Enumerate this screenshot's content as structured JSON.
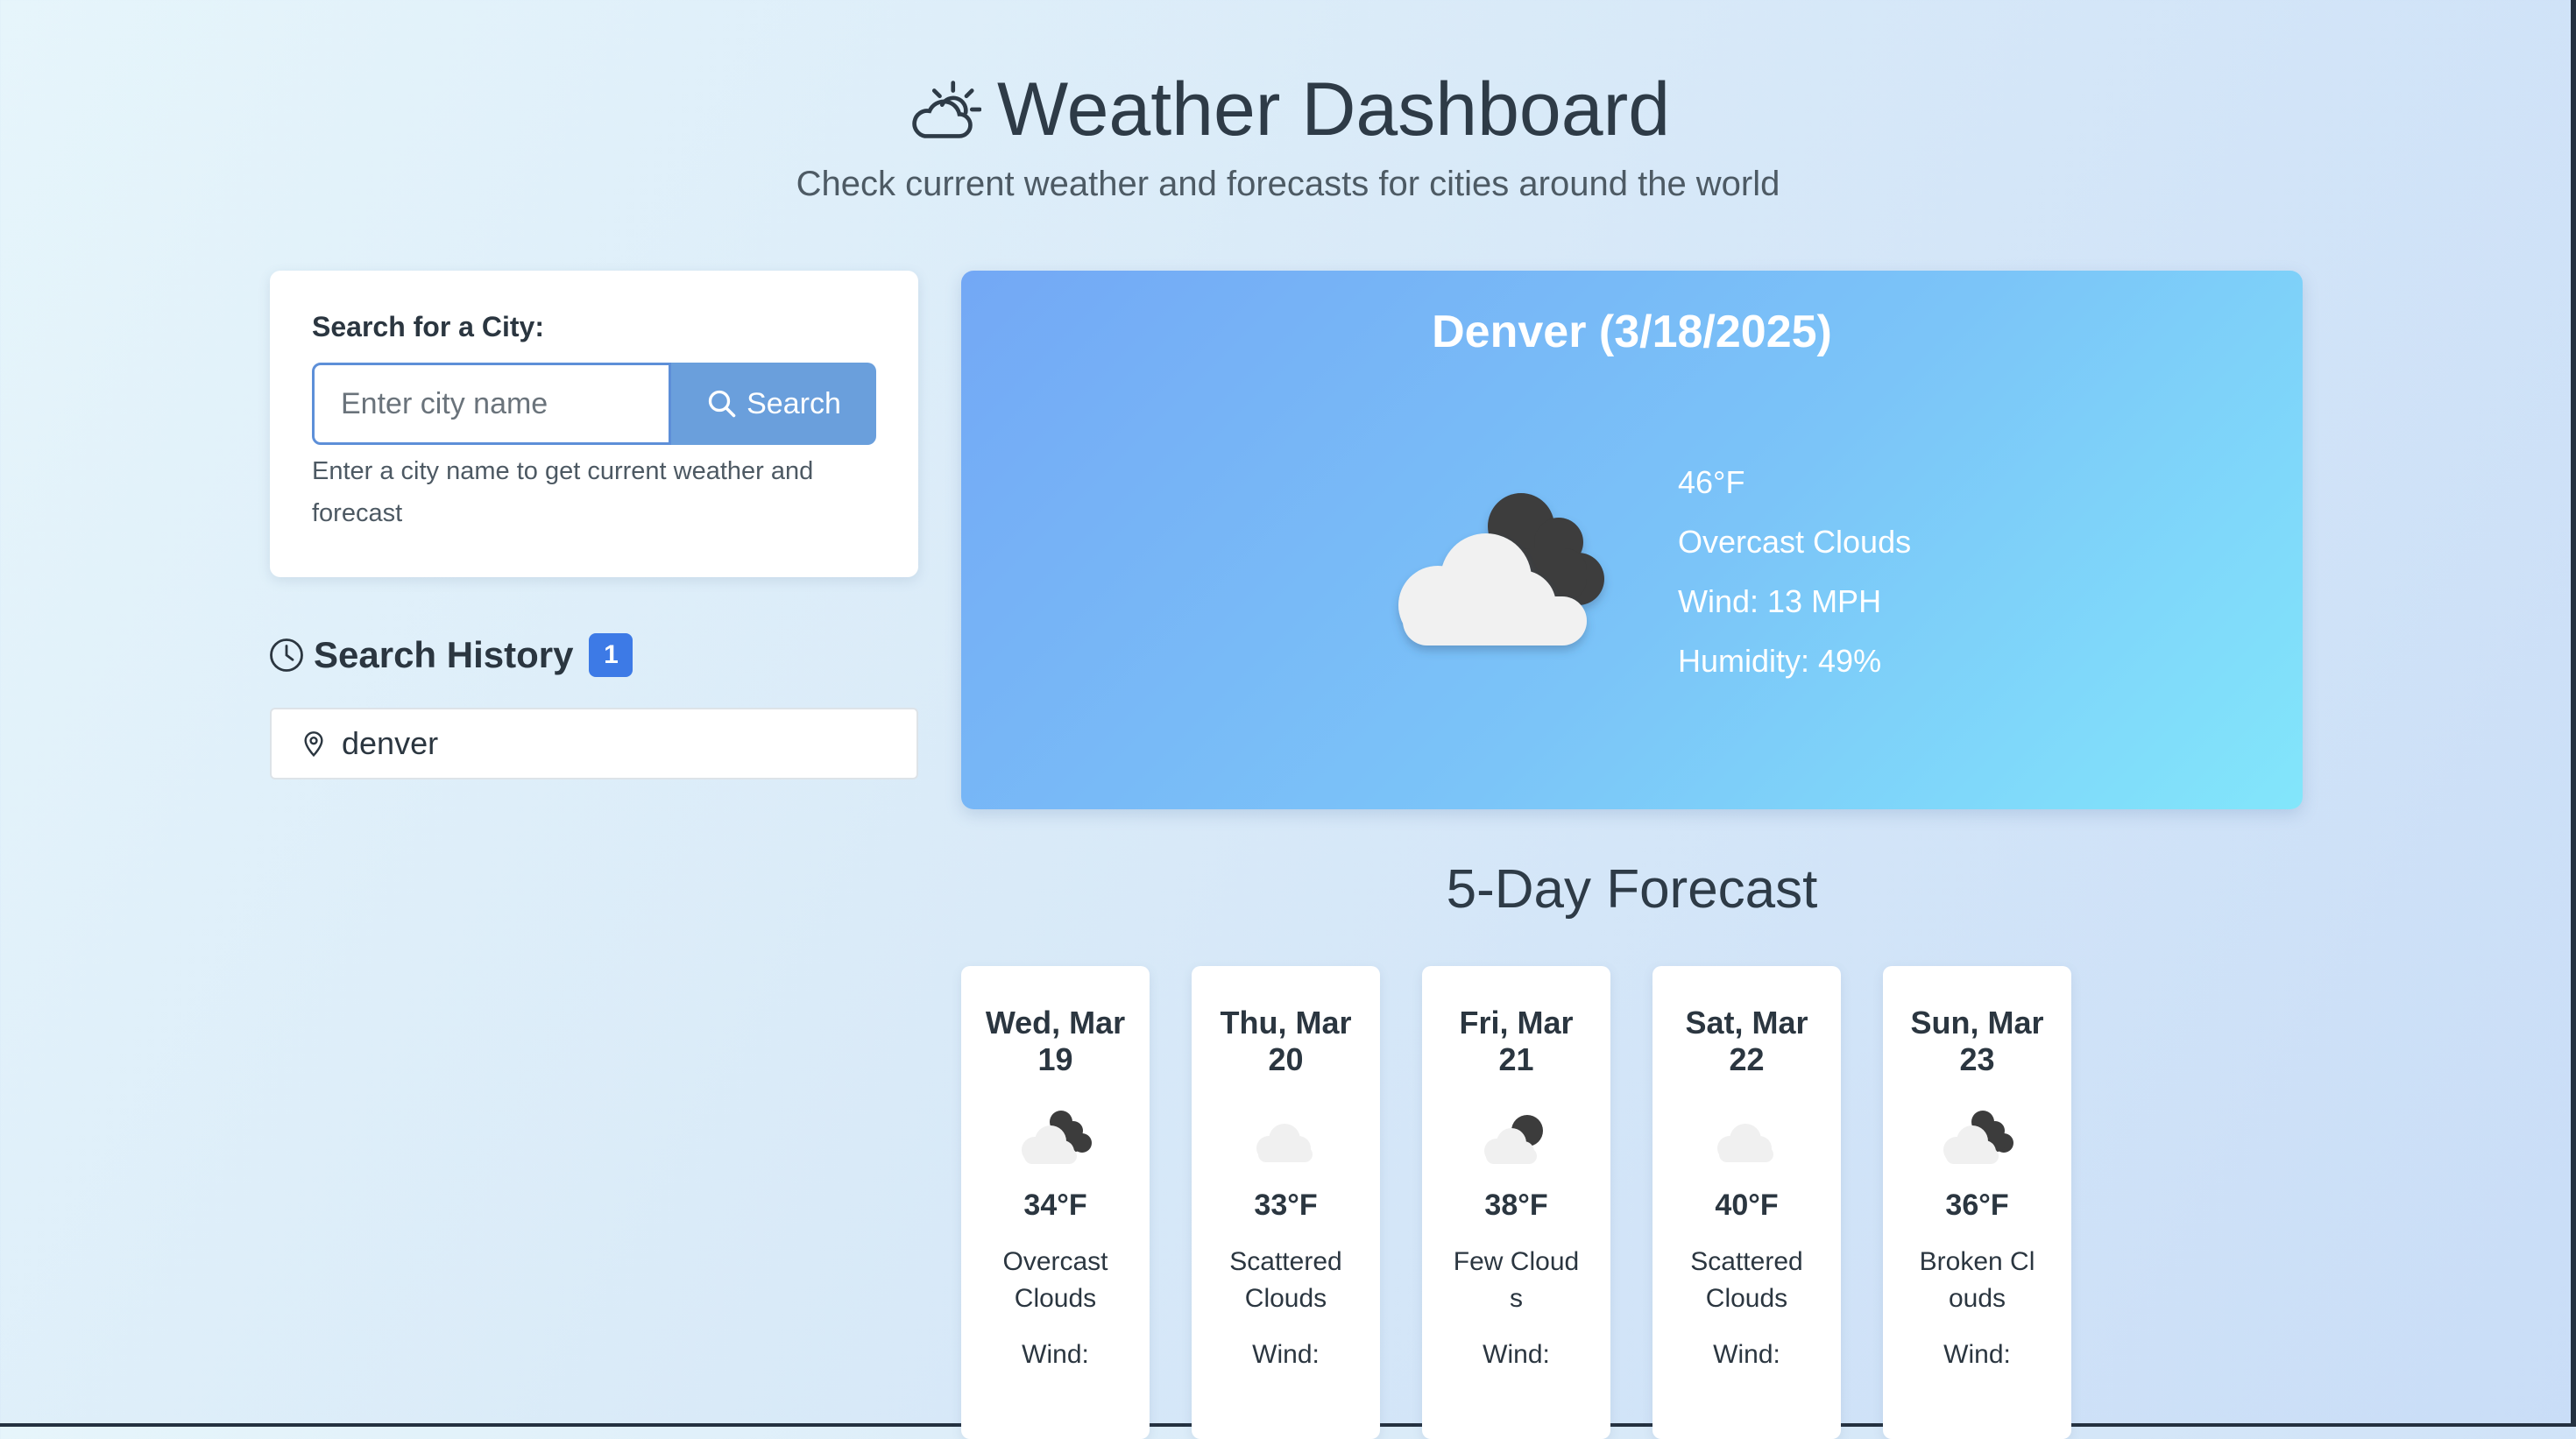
{
  "header": {
    "title": "Weather Dashboard",
    "subtitle": "Check current weather and forecasts for cities around the world",
    "icon": "partly-sunny-icon"
  },
  "search": {
    "label": "Search for a City:",
    "placeholder": "Enter city name",
    "value": "",
    "button_label": "Search",
    "help": "Enter a city name to get current weather and forecast"
  },
  "history": {
    "title": "Search History",
    "count": "1",
    "items": [
      {
        "city": "denver"
      }
    ]
  },
  "current": {
    "title": "Denver (3/18/2025)",
    "temp": "46°F",
    "description": "Overcast Clouds",
    "wind": "Wind: 13 MPH",
    "humidity": "Humidity: 49%",
    "icon": "overcast-clouds-icon"
  },
  "forecast": {
    "title": "5-Day Forecast",
    "days": [
      {
        "date": "Wed, Mar 19",
        "temp": "34°F",
        "desc": "Overcast Clouds",
        "wind": "Wind:",
        "icon": "broken-clouds-icon"
      },
      {
        "date": "Thu, Mar 20",
        "temp": "33°F",
        "desc": "Scattered Clouds",
        "wind": "Wind:",
        "icon": "scattered-clouds-icon"
      },
      {
        "date": "Fri, Mar 21",
        "temp": "38°F",
        "desc": "Few Clouds",
        "wind": "Wind:",
        "icon": "few-clouds-icon"
      },
      {
        "date": "Sat, Mar 22",
        "temp": "40°F",
        "desc": "Scattered Clouds",
        "wind": "Wind:",
        "icon": "scattered-clouds-icon"
      },
      {
        "date": "Sun, Mar 23",
        "temp": "36°F",
        "desc": "Broken Clouds",
        "wind": "Wind:",
        "icon": "broken-clouds-icon"
      }
    ]
  },
  "colors": {
    "accent": "#3d7ae6",
    "search_button": "#6a9fdc",
    "current_gradient_start": "#73a8f5",
    "current_gradient_end": "#82e6fb"
  }
}
